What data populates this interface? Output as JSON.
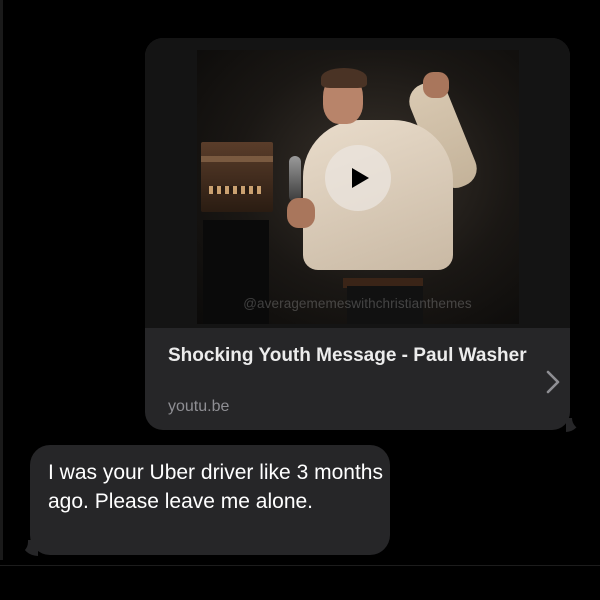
{
  "link_preview": {
    "watermark": "@averagememeswithchristianthemes",
    "title": "Shocking Youth Message - Paul Washer",
    "domain": "youtu.be",
    "play_icon": "play-icon",
    "chevron_icon": "chevron-right-icon"
  },
  "messages": [
    {
      "text": "I was your Uber driver like 3 months ago. Please leave me alone."
    }
  ],
  "colors": {
    "background": "#000000",
    "bubble": "#262628",
    "title_text": "#ececec",
    "domain_text": "#8e8e93",
    "message_text": "#ffffff"
  }
}
